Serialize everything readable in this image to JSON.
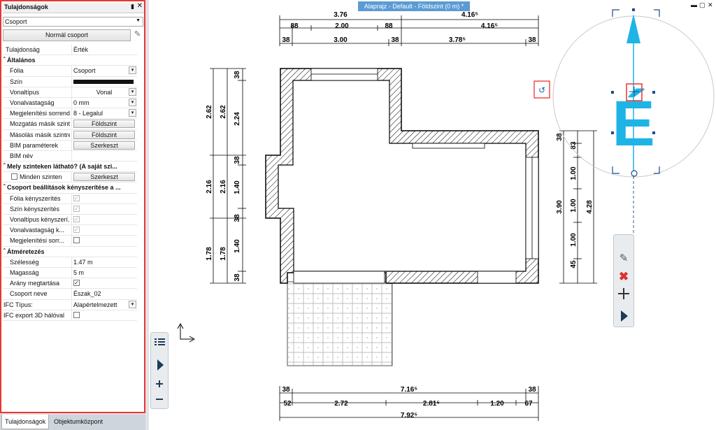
{
  "panel": {
    "title": "Tulajdonságok",
    "close": "✕",
    "pin": "ᵖ",
    "combo_value": "Csoport",
    "group_button": "Normál csoport",
    "header": {
      "key": "Tulajdonság",
      "value": "Érték"
    },
    "sections": {
      "general": "Általános",
      "visible_levels": "Mely szinteken látható? (A saját szi...",
      "group_settings": "Csoport beállítások kényszerítése a ...",
      "resize": "Átméretezés"
    },
    "rows": {
      "folia": {
        "key": "Fólia",
        "value": "Csoport"
      },
      "szin": {
        "key": "Szín"
      },
      "vonaltipus": {
        "key": "Vonaltípus",
        "value": "Vonal"
      },
      "vonalvastagsag": {
        "key": "Vonalvastagság",
        "value": "0 mm"
      },
      "megjelenitesi": {
        "key": "Megjelenítési sorrend",
        "value": "8 - Legalul"
      },
      "mozgatas": {
        "key": "Mozgatás másik szintre",
        "value": "Földszint"
      },
      "masolas": {
        "key": "Másolás másik szintre",
        "value": "Földszint"
      },
      "bim_param": {
        "key": "BIM paraméterek",
        "value": "Szerkeszt"
      },
      "bim_nev": {
        "key": "BIM név",
        "value": ""
      },
      "minden_szinten": {
        "key": "Minden szinten",
        "value": "Szerkeszt"
      },
      "folia_k": {
        "key": "Fólia kényszerítés"
      },
      "szin_k": {
        "key": "Szín kényszerítés"
      },
      "vonaltipus_k": {
        "key": "Vonaltípus kényszerí..."
      },
      "vonalvast_k": {
        "key": "Vonalvastagság k..."
      },
      "megjel_k": {
        "key": "Megjelenítési sorr..."
      },
      "szelesseg": {
        "key": "Szélesség",
        "value": "1.47 m"
      },
      "magassag": {
        "key": "Magasság",
        "value": "5 m"
      },
      "arany": {
        "key": "Arány megtartása"
      },
      "csoport_neve": {
        "key": "Csoport neve",
        "value": "Észak_02"
      },
      "ifc_tipus": {
        "key": "IFC Típus:",
        "value": "Alapértelmezett"
      },
      "ifc_export": {
        "key": "IFC export 3D hálóval"
      }
    }
  },
  "tabs": [
    "Tulajdonságok",
    "Objektumközpont"
  ],
  "window": {
    "title": "Alaprajz - Default - Földszint (0 m) *"
  },
  "dimensions": {
    "top": [
      "3.76",
      "4.16⁵",
      "88",
      "2.00",
      "88",
      "4.16⁵",
      "38",
      "3.00",
      "38",
      "3.78⁵",
      "38"
    ],
    "left": [
      "2.62",
      "2.62",
      "2.24",
      "38",
      "38",
      "2.16",
      "2.16",
      "1.40",
      "38",
      "1.78",
      "1.78",
      "1.40",
      "38"
    ],
    "right": [
      "38",
      "83",
      "1.00",
      "1.00",
      "1.00",
      "45",
      "3.90",
      "4.28"
    ],
    "bottom": [
      "38",
      "7.16⁵",
      "38",
      "52",
      "2.72",
      "2.81⁵",
      "1.20",
      "67",
      "7.92⁵"
    ]
  },
  "north_letter": "É",
  "colors": {
    "accent": "#1fb4e6",
    "selection": "#e33333",
    "title_blue": "#5b9bd5"
  },
  "icons": {
    "rotate": "rotate-icon",
    "pencil": "pencil-icon",
    "delete": "delete-icon",
    "move": "move-icon"
  }
}
